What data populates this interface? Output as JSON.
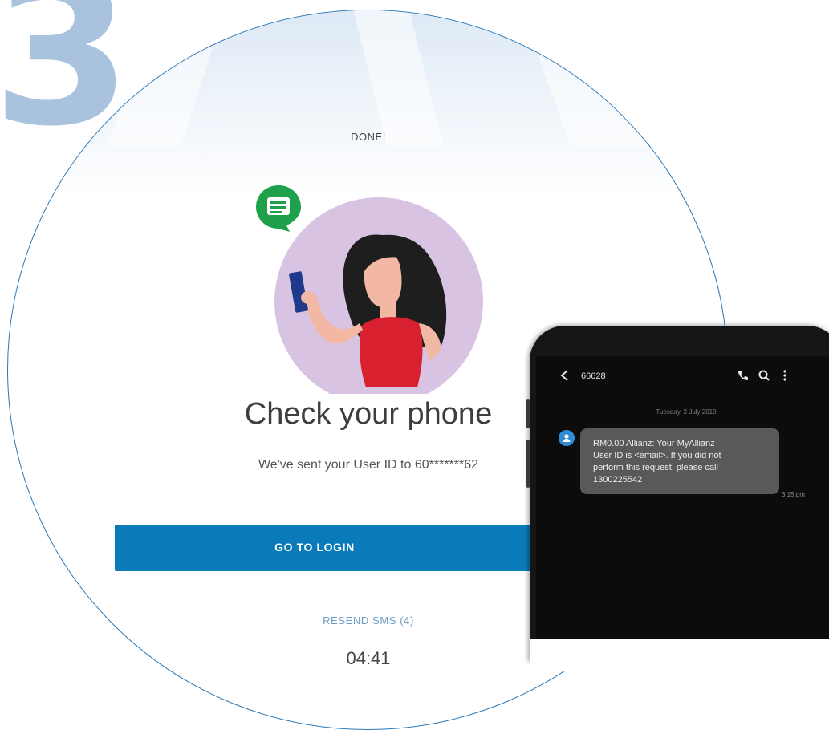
{
  "step": {
    "number": "3"
  },
  "screen": {
    "done_label": "DONE!",
    "title": "Check your phone",
    "subtitle": "We've sent your User ID to 60*******62",
    "login_button": "GO TO LOGIN",
    "resend_link": "RESEND SMS (4)",
    "timer": "04:41"
  },
  "phone": {
    "sender": "66628",
    "date_separator": "Tuesday, 2 July 2019",
    "message": {
      "text": "RM0.00 Allianz: Your MyAllianz\nUser ID is <email>.  If you did not\nperform this request, please call\n1300225542",
      "time": "3:15 pm"
    },
    "icons": [
      "back-icon",
      "call-icon",
      "search-icon",
      "more-icon"
    ]
  },
  "colors": {
    "step_number": "#a9c2de",
    "circle_border": "#2a78b8",
    "login_button": "#0a7ab8",
    "resend_link": "#6a9cc5",
    "chat_icon": "#1fa04a",
    "illustration_bg": "#d9c3e3",
    "dress": "#d9202f",
    "hair": "#1e1e1e",
    "avatar": "#2f8dd6"
  }
}
